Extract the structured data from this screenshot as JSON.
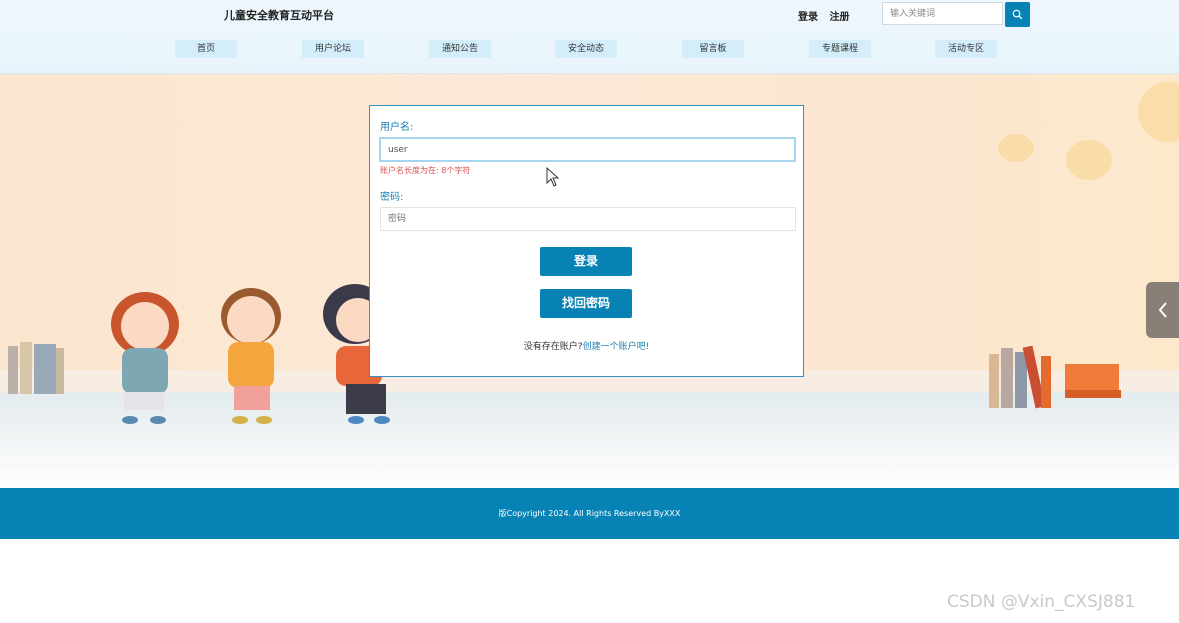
{
  "header": {
    "site_title": "儿童安全教育互动平台",
    "login_link": "登录",
    "register_link": "注册",
    "search_placeholder": "输入关键词",
    "search_icon": "search-icon"
  },
  "nav": {
    "items": [
      {
        "label": "首页"
      },
      {
        "label": "用户论坛"
      },
      {
        "label": "通知公告"
      },
      {
        "label": "安全动态"
      },
      {
        "label": "留言板"
      },
      {
        "label": "专题课程"
      },
      {
        "label": "活动专区"
      }
    ]
  },
  "login": {
    "username_label": "用户名:",
    "username_value": "user",
    "username_error": "账户名长度为在: 8个字符",
    "password_label": "密码:",
    "password_placeholder": "密码",
    "login_button": "登录",
    "recover_button": "找回密码",
    "signup_prompt": "没有存在账户?",
    "signup_link": "创建一个账户吧!"
  },
  "side_arrow_icon": "chevron-left-icon",
  "footer": {
    "copyright": "版Copyright 2024. All Rights Reserved ByXXX"
  },
  "watermark": "CSDN @Vxin_CXSJ881",
  "colors": {
    "accent": "#0782b4",
    "nav_bg": "#d3eef9",
    "error": "#d9534f"
  }
}
